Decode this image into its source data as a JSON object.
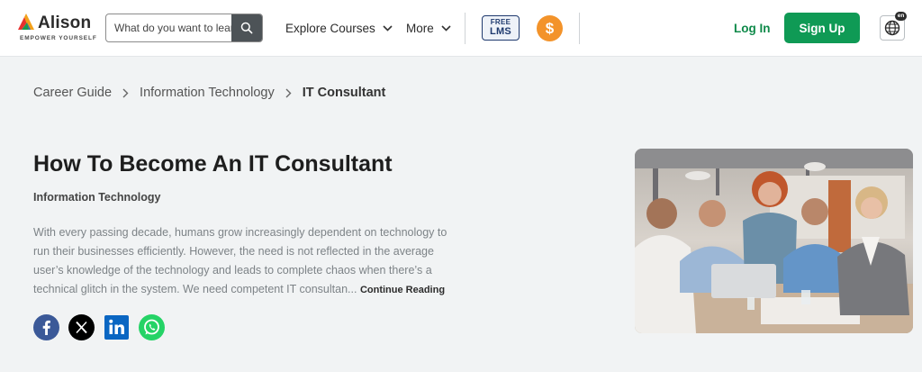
{
  "brand": {
    "name": "Alison",
    "tagline": "EMPOWER YOURSELF"
  },
  "search": {
    "placeholder": "What do you want to learn?",
    "value": ""
  },
  "nav": {
    "explore": "Explore Courses",
    "more": "More"
  },
  "badges": {
    "free_lms_line1": "FREE",
    "free_lms_line2": "LMS",
    "dollar": "$"
  },
  "auth": {
    "login": "Log In",
    "signup": "Sign Up"
  },
  "language": {
    "code": "en"
  },
  "breadcrumb": [
    {
      "label": "Career Guide"
    },
    {
      "label": "Information Technology"
    },
    {
      "label": "IT Consultant"
    }
  ],
  "article": {
    "title": "How To Become An IT Consultant",
    "category": "Information Technology",
    "excerpt": "With every passing decade, humans grow increasingly dependent on technology to run their businesses efficiently. However, the need is not reflected in the average user’s knowledge of the technology and leads to complete chaos when there’s a technical glitch in the system.   We need competent IT consultan...",
    "continue_label": "Continue Reading"
  },
  "socials": [
    "facebook-icon",
    "x-icon",
    "linkedin-icon",
    "whatsapp-icon"
  ],
  "colors": {
    "brand_green": "#0f9a55",
    "accent_orange": "#f3932a",
    "facebook": "#3b5998",
    "linkedin": "#0a66c2",
    "whatsapp": "#25d366"
  }
}
